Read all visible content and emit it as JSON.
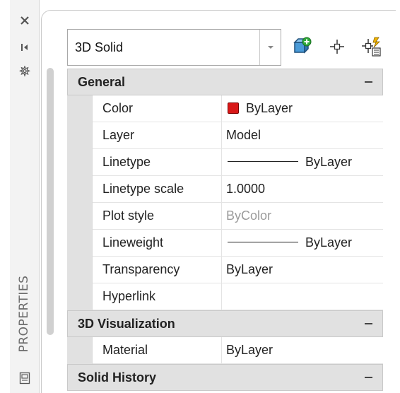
{
  "palette": {
    "title": "PROPERTIES",
    "strip_icons": [
      "close-icon",
      "auto-hide-icon",
      "properties-menu-icon"
    ],
    "bottom_icon": "panel-icon"
  },
  "toolbar": {
    "object_type": "3D Solid",
    "tools": [
      "toggle-pickadd-icon",
      "select-objects-icon",
      "quick-select-icon"
    ]
  },
  "sections": {
    "general": {
      "label": "General",
      "toggle": "−",
      "rows": [
        {
          "name": "Color",
          "value": "ByLayer"
        },
        {
          "name": "Layer",
          "value": "Model"
        },
        {
          "name": "Linetype",
          "value": "ByLayer"
        },
        {
          "name": "Linetype scale",
          "value": "1.0000"
        },
        {
          "name": "Plot style",
          "value": "ByColor"
        },
        {
          "name": "Lineweight",
          "value": "ByLayer"
        },
        {
          "name": "Transparency",
          "value": "ByLayer"
        },
        {
          "name": "Hyperlink",
          "value": ""
        }
      ]
    },
    "visualization": {
      "label": "3D Visualization",
      "toggle": "−",
      "rows": [
        {
          "name": "Material",
          "value": "ByLayer"
        }
      ]
    },
    "solid_history": {
      "label": "Solid History",
      "toggle": "−"
    }
  },
  "colors": {
    "color_swatch": "#d81818",
    "category_bg": "#e1e1e1",
    "muted_text": "#9b9b9b"
  }
}
